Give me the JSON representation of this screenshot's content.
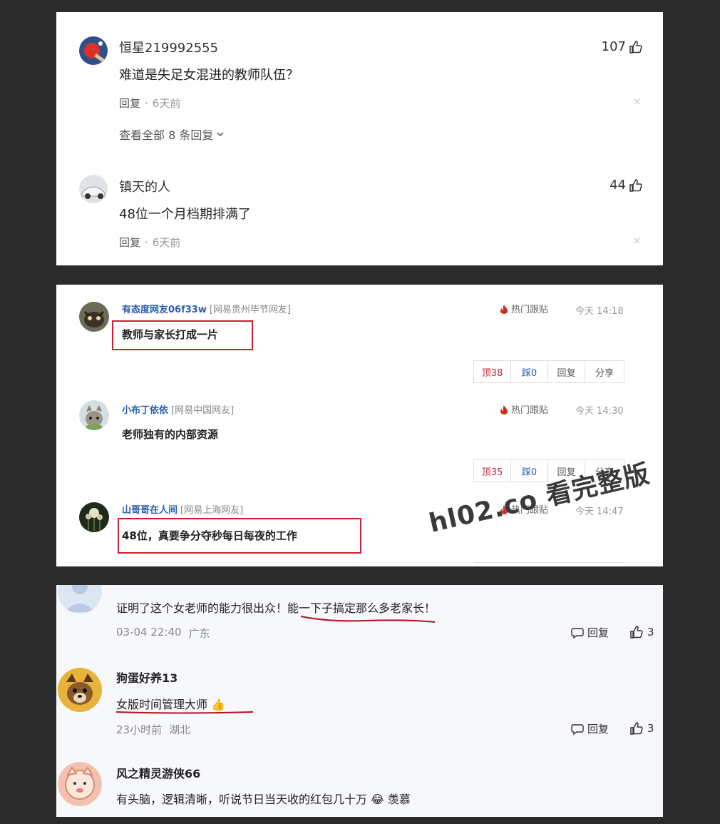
{
  "panel1": {
    "comments": [
      {
        "name": "恒星219992555",
        "text": "难道是失足女混进的教师队伍？",
        "likes": "107",
        "reply_label": "回复",
        "dot": "·",
        "time": "6天前",
        "close": "×",
        "view_all": "查看全部 8 条回复"
      },
      {
        "name": "镇天的人",
        "text": "48位一个月档期排满了",
        "likes": "44",
        "reply_label": "回复",
        "dot": "·",
        "time": "6天前",
        "close": "×"
      }
    ]
  },
  "panel2": {
    "comments": [
      {
        "user": "有态度网友06f33w",
        "region": "[网易贵州毕节网友]",
        "hot": "热门跟贴",
        "time": "今天 14:18",
        "text": "教师与家长打成一片",
        "up": "顶38",
        "down": "踩0",
        "reply": "回复",
        "share": "分享"
      },
      {
        "user": "小布丁依依",
        "region": "[网易中国网友]",
        "hot": "热门跟贴",
        "time": "今天 14:30",
        "text": "老师独有的内部资源",
        "up": "顶35",
        "down": "踩0",
        "reply": "回复",
        "share": "分享"
      },
      {
        "user": "山哥哥在人间",
        "region": "[网易上海网友]",
        "hot": "热门跟贴",
        "time": "今天 14:47",
        "text": "48位，真要争分夺秒每日每夜的工作"
      }
    ]
  },
  "panel3": {
    "comments": [
      {
        "text": "证明了这个女老师的能力很出众！能一下子搞定那么多老家长！",
        "date": "03-04 22:40",
        "location": "广东",
        "reply": "回复",
        "likes": "3"
      },
      {
        "name": "狗蛋好养13",
        "text": "女版时间管理大师",
        "emoji": "👍",
        "date": "23小时前",
        "location": "湖北",
        "reply": "回复",
        "likes": "3"
      },
      {
        "name": "风之精灵游侠66",
        "text": "有头脑，逻辑清晰，听说节日当天收的红包几十万",
        "emoji": "😂",
        "suffix": "羡慕"
      }
    ]
  },
  "watermark": "hl02.co 看完整版",
  "colors": {
    "background": "#2b2b2b",
    "red_box": "#c8232c",
    "link_blue": "#2a5db0",
    "underline_red": "#b0121b"
  },
  "icons": [
    "thumbs-up-icon",
    "fire-icon",
    "comment-bubble-icon",
    "chevron-down-icon",
    "close-icon"
  ]
}
